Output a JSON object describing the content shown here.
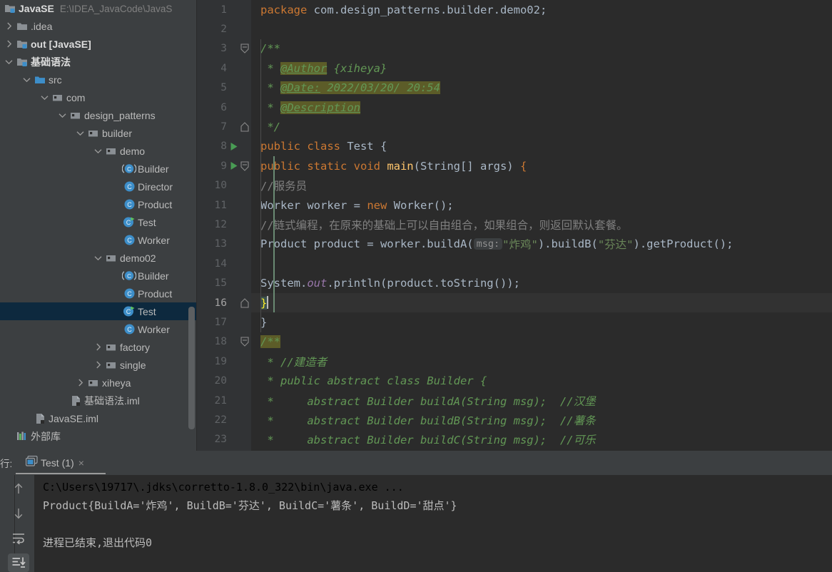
{
  "project": {
    "name": "JavaSE",
    "path": "E:\\IDEA_JavaCode\\JavaS",
    "tree": [
      {
        "label": ".idea",
        "depth": 1,
        "twisty": "right",
        "icon": "folder-icon",
        "kind": "folder"
      },
      {
        "label": "out [JavaSE]",
        "depth": 1,
        "twisty": "right",
        "icon": "folder-module-icon",
        "kind": "folder",
        "bold": true
      },
      {
        "label": "基础语法",
        "depth": 1,
        "twisty": "down",
        "icon": "folder-module-icon",
        "kind": "folder",
        "bold": true
      },
      {
        "label": "src",
        "depth": 2,
        "twisty": "down",
        "icon": "source-root-icon",
        "kind": "folder"
      },
      {
        "label": "com",
        "depth": 3,
        "twisty": "down",
        "icon": "package-icon",
        "kind": "package"
      },
      {
        "label": "design_patterns",
        "depth": 4,
        "twisty": "down",
        "icon": "package-icon",
        "kind": "package"
      },
      {
        "label": "builder",
        "depth": 5,
        "twisty": "down",
        "icon": "package-icon",
        "kind": "package"
      },
      {
        "label": "demo",
        "depth": 6,
        "twisty": "down",
        "icon": "package-icon",
        "kind": "package"
      },
      {
        "label": "Builder",
        "depth": 7,
        "twisty": "none",
        "icon": "abstract-class-icon",
        "kind": "class"
      },
      {
        "label": "Director",
        "depth": 7,
        "twisty": "none",
        "icon": "class-icon",
        "kind": "class"
      },
      {
        "label": "Product",
        "depth": 7,
        "twisty": "none",
        "icon": "class-icon",
        "kind": "class"
      },
      {
        "label": "Test",
        "depth": 7,
        "twisty": "none",
        "icon": "runnable-class-icon",
        "kind": "class"
      },
      {
        "label": "Worker",
        "depth": 7,
        "twisty": "none",
        "icon": "class-icon",
        "kind": "class"
      },
      {
        "label": "demo02",
        "depth": 6,
        "twisty": "down",
        "icon": "package-icon",
        "kind": "package"
      },
      {
        "label": "Builder",
        "depth": 7,
        "twisty": "none",
        "icon": "abstract-class-icon",
        "kind": "class"
      },
      {
        "label": "Product",
        "depth": 7,
        "twisty": "none",
        "icon": "class-icon",
        "kind": "class"
      },
      {
        "label": "Test",
        "depth": 7,
        "twisty": "none",
        "icon": "runnable-class-icon",
        "kind": "class",
        "selected": true
      },
      {
        "label": "Worker",
        "depth": 7,
        "twisty": "none",
        "icon": "class-icon",
        "kind": "class"
      },
      {
        "label": "factory",
        "depth": 6,
        "twisty": "right",
        "icon": "package-icon",
        "kind": "package"
      },
      {
        "label": "single",
        "depth": 6,
        "twisty": "right",
        "icon": "package-icon",
        "kind": "package"
      },
      {
        "label": "xiheya",
        "depth": 5,
        "twisty": "right",
        "icon": "package-icon",
        "kind": "package"
      },
      {
        "label": "基础语法.iml",
        "depth": 4,
        "twisty": "none",
        "icon": "iml-file-icon",
        "kind": "file"
      },
      {
        "label": "JavaSE.iml",
        "depth": 2,
        "twisty": "none",
        "icon": "iml-file-icon",
        "kind": "file"
      },
      {
        "label": "外部库",
        "depth": 1,
        "twisty": "none",
        "icon": "external-libraries-icon",
        "kind": "library"
      }
    ]
  },
  "editor": {
    "lines": [
      {
        "num": "1",
        "run": false,
        "fold": "none"
      },
      {
        "num": "2",
        "run": false,
        "fold": "none"
      },
      {
        "num": "3",
        "run": false,
        "fold": "start"
      },
      {
        "num": "4",
        "run": false,
        "fold": "none"
      },
      {
        "num": "5",
        "run": false,
        "fold": "none"
      },
      {
        "num": "6",
        "run": false,
        "fold": "none"
      },
      {
        "num": "7",
        "run": false,
        "fold": "end"
      },
      {
        "num": "8",
        "run": true,
        "fold": "none"
      },
      {
        "num": "9",
        "run": true,
        "fold": "start"
      },
      {
        "num": "10",
        "run": false,
        "fold": "none"
      },
      {
        "num": "11",
        "run": false,
        "fold": "none"
      },
      {
        "num": "12",
        "run": false,
        "fold": "none"
      },
      {
        "num": "13",
        "run": false,
        "fold": "none"
      },
      {
        "num": "14",
        "run": false,
        "fold": "none"
      },
      {
        "num": "15",
        "run": false,
        "fold": "none"
      },
      {
        "num": "16",
        "run": false,
        "fold": "end",
        "current": true
      },
      {
        "num": "17",
        "run": false,
        "fold": "none"
      },
      {
        "num": "18",
        "run": false,
        "fold": "start"
      },
      {
        "num": "19",
        "run": false,
        "fold": "none"
      },
      {
        "num": "20",
        "run": false,
        "fold": "none"
      },
      {
        "num": "21",
        "run": false,
        "fold": "none"
      },
      {
        "num": "22",
        "run": false,
        "fold": "none"
      },
      {
        "num": "23",
        "run": false,
        "fold": "none"
      }
    ],
    "code": {
      "l1_package_kw": "package",
      "l1_package_name": " com.design_patterns.builder.demo02;",
      "l3": "/**",
      "l4_star": " * ",
      "l4_tag": "@Author",
      "l4_rest": " {xiheya}",
      "l5_star": " * ",
      "l5_tag": "@Date:",
      "l5_rest": " 2022/03/20/ 20:54",
      "l6_star": " * ",
      "l6_tag": "@Description",
      "l7": " */",
      "l8_kw": "public class",
      "l8_name": " Test",
      "l8_brace": " {",
      "l9_kw": "public static void",
      "l9_name": " main",
      "l9_args": "(String[] args)",
      "l9_brace": " {",
      "l10_comment": "//服务员",
      "l11_type": "Worker worker = ",
      "l11_kw": "new",
      "l11_rest": " Worker();",
      "l12_comment": "//链式编程，在原来的基础上可以自由组合，如果组合，则返回默认套餐。",
      "l13_a": "Product product = worker.buildA(",
      "l13_hint": "msg:",
      "l13_b": "\"炸鸡\"",
      "l13_c": ").buildB(",
      "l13_d": "\"芬达\"",
      "l13_e": ").getProduct();",
      "l15_a": "System.",
      "l15_out": "out",
      "l15_b": ".println(product.toString());",
      "l16_brace": "}",
      "l17_brace": "}",
      "l18": "/**",
      "l19": " * //建造者",
      "l20": " * public abstract class Builder {",
      "l21": " *     abstract Builder buildA(String msg);  //汉堡",
      "l22": " *     abstract Builder buildB(String msg);  //薯条",
      "l23": " *     abstract Builder buildC(String msg);  //可乐"
    }
  },
  "bottom_panel": {
    "label": "行:",
    "tab": {
      "title": "Test (1)",
      "close": "×"
    },
    "toolbar": [
      {
        "name": "up-arrow-icon",
        "active": false
      },
      {
        "name": "down-arrow-icon",
        "active": false
      },
      {
        "name": "soft-wrap-icon",
        "active": false
      },
      {
        "name": "scroll-to-end-icon",
        "active": true
      }
    ],
    "console": {
      "command": "C:\\Users\\19717\\.jdks\\corretto-1.8.0_322\\bin\\java.exe ...",
      "output": "Product{BuildA='炸鸡', BuildB='芬达', BuildC='薯条', BuildD='甜点'}",
      "exit": "进程已结束,退出代码0"
    }
  },
  "colors": {
    "sidebar_bg": "#3c3f41",
    "editor_bg": "#2b2b2b",
    "gutter_bg": "#313335",
    "selection_bg": "#0d293e",
    "keyword": "#cc7832",
    "string": "#6a8759",
    "comment": "#808080",
    "javadoc": "#629755",
    "javadoc_highlight": "#5c5c28",
    "identifier": "#a9b7c6",
    "method": "#ffc66d",
    "static_field": "#9876aa",
    "run_green": "#499c54",
    "class_icon_blue": "#3d8ec9"
  }
}
